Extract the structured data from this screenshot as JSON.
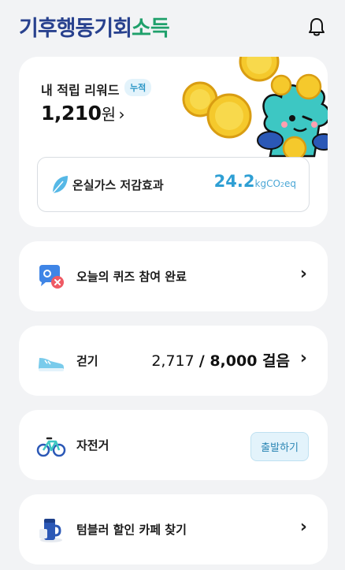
{
  "header": {
    "logo_main": "기후행동기회",
    "logo_accent": "소득",
    "icon": "bell-icon"
  },
  "reward": {
    "title": "내 적립 리워드",
    "badge": "누적",
    "amount": "1,210",
    "unit": "원",
    "chevron": "›"
  },
  "co2": {
    "label": "온실가스 저감효과",
    "value": "24.2",
    "unit_kg": "kg",
    "unit_co": "CO",
    "unit_sub": "2",
    "unit_eq": "eq",
    "icon": "leaf-icon"
  },
  "rows": [
    {
      "label": "오늘의 퀴즈 참여 완료",
      "icon": "quiz-icon",
      "chevron": "›"
    },
    {
      "label": "걷기",
      "icon": "shoe-icon",
      "current": "2,717",
      "goal": "/ 8,000 걸음",
      "chevron": "›"
    },
    {
      "label": "자전거",
      "icon": "bicycle-icon",
      "button": "출발하기"
    },
    {
      "label": "텀블러 할인 카페 찾기",
      "icon": "tumbler-icon",
      "chevron": "›"
    }
  ],
  "colors": {
    "background": "#f2f3f5",
    "brand_navy": "#28418e",
    "brand_green": "#1fa06b",
    "accent_blue": "#2e9fd4"
  }
}
